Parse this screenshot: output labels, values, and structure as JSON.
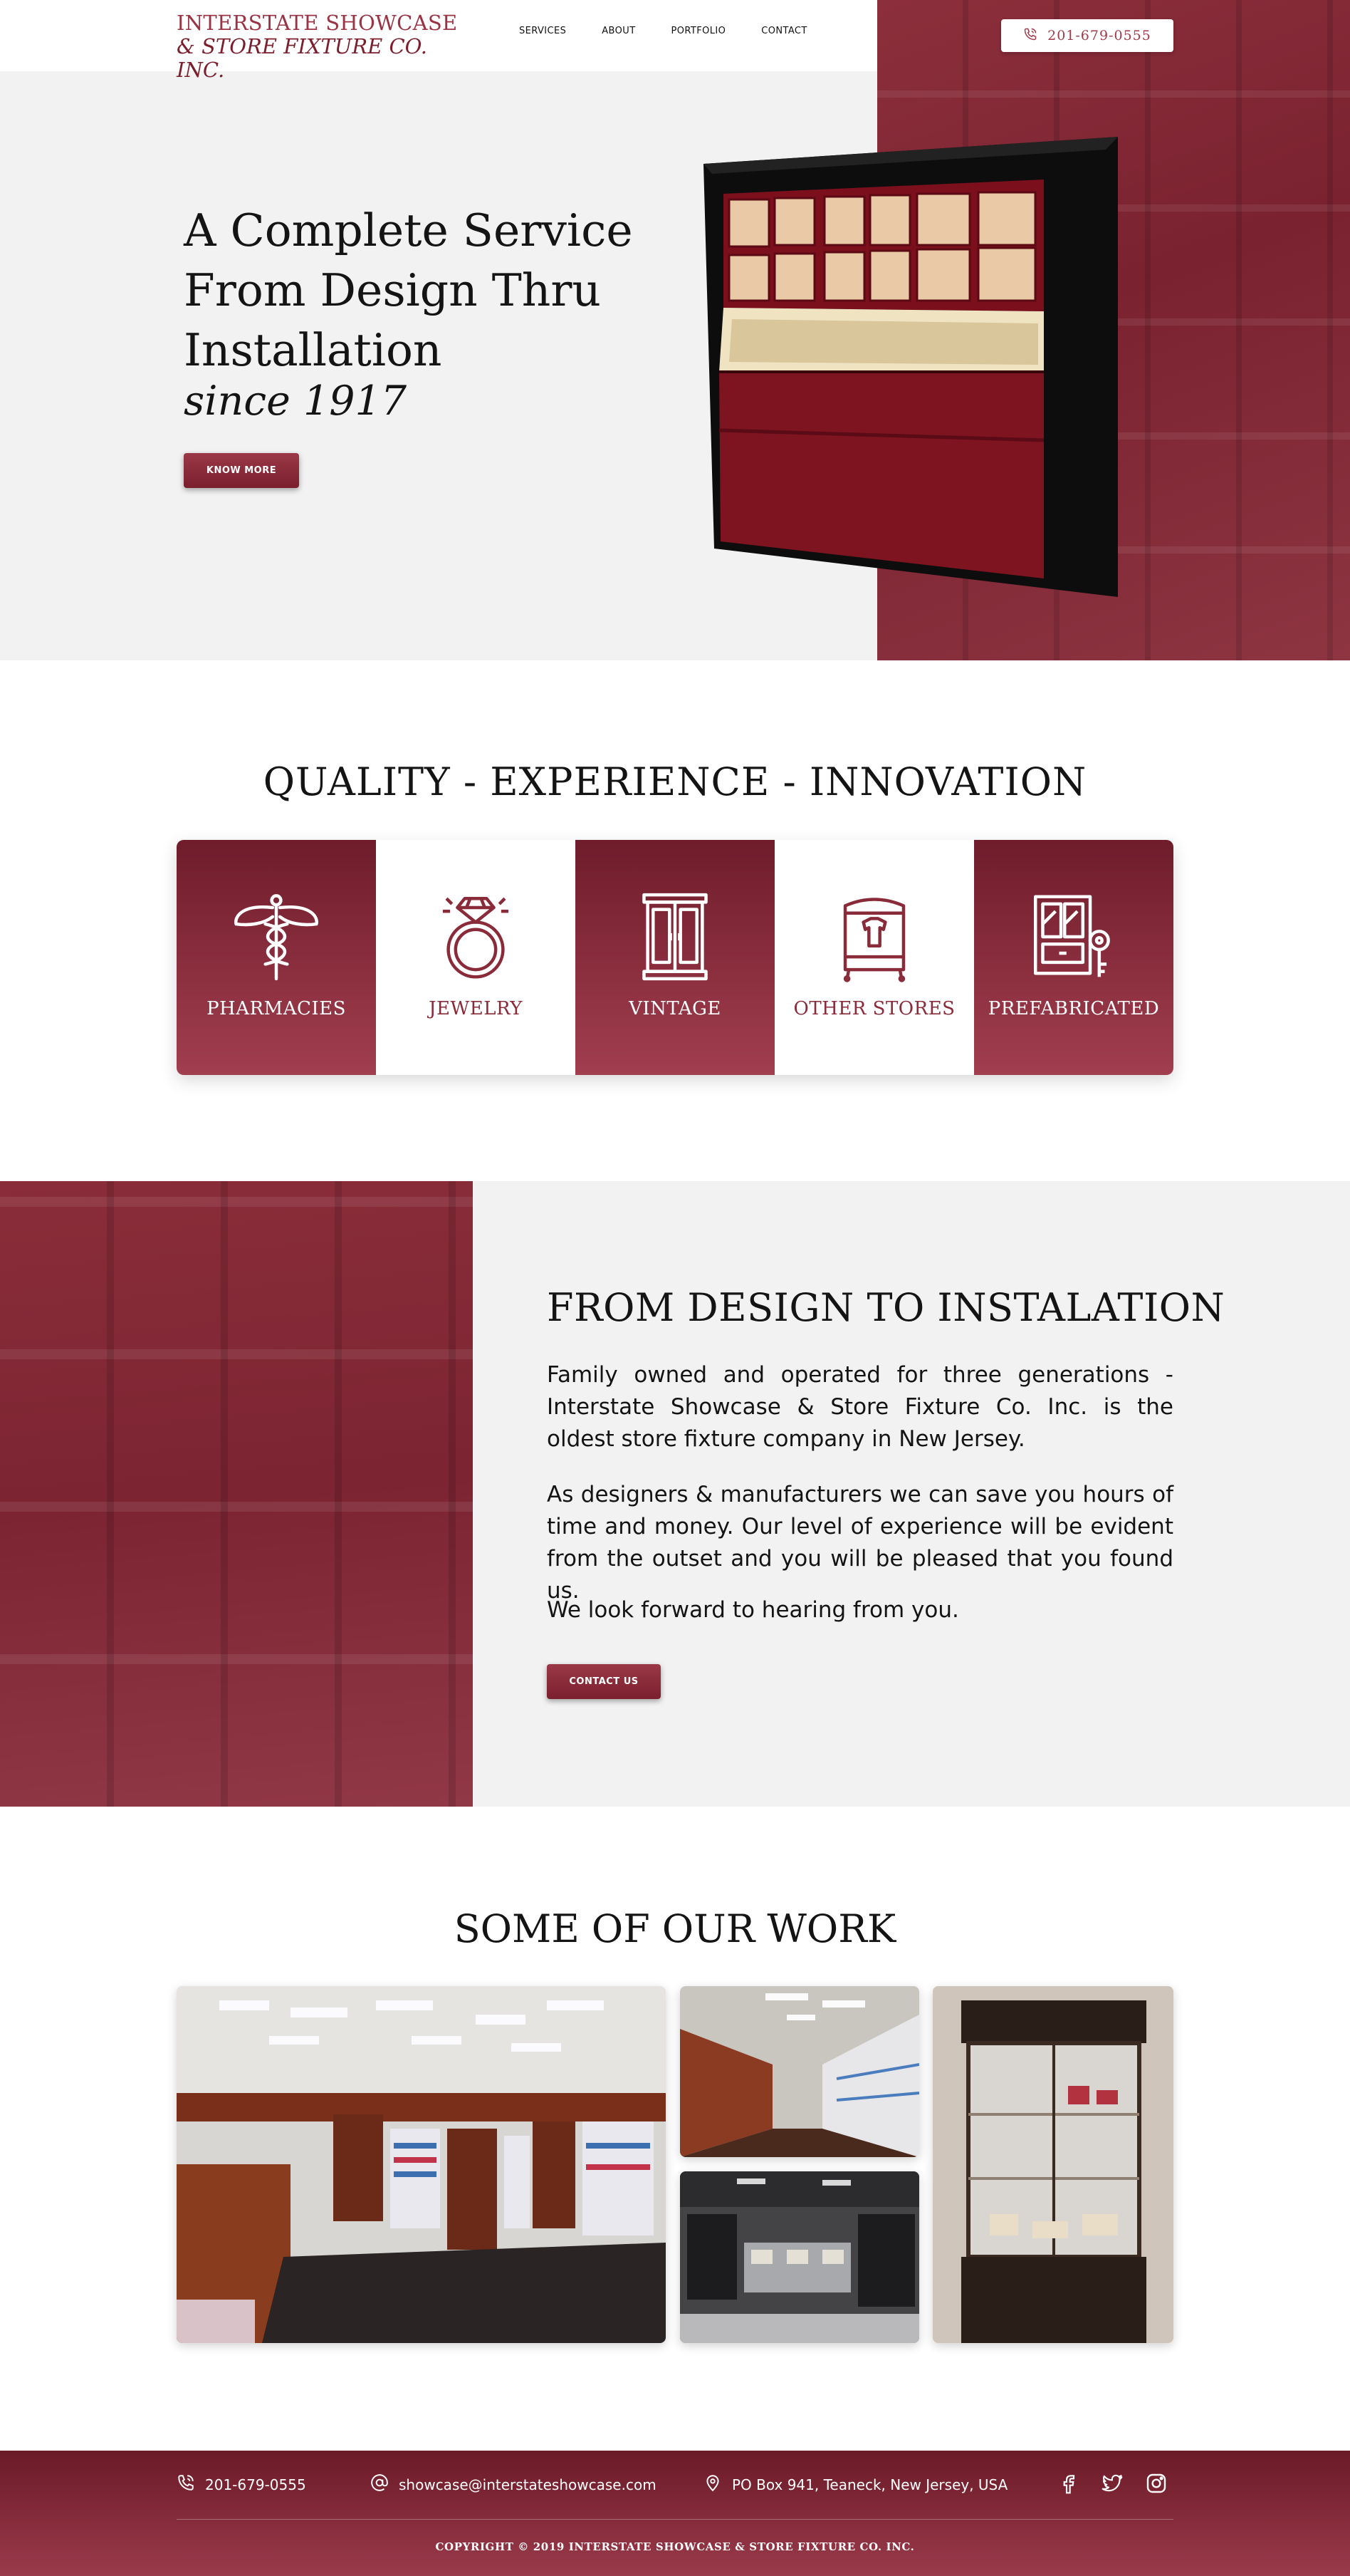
{
  "header": {
    "logo_line1": "INTERSTATE SHOWCASE",
    "logo_line2": "& STORE FIXTURE CO. INC.",
    "nav": [
      "SERVICES",
      "ABOUT",
      "PORTFOLIO",
      "CONTACT"
    ],
    "phone": "201-679-0555",
    "phone_icon": "phone-icon"
  },
  "hero": {
    "title": "A Complete Service From Design Thru Installation",
    "subtitle": "since 1917",
    "button": "KNOW MORE"
  },
  "quality": {
    "title": "QUALITY - EXPERIENCE - INNOVATION",
    "cards": [
      {
        "label": "PHARMACIES",
        "icon": "caduceus-icon",
        "style": "dark"
      },
      {
        "label": "JEWELRY",
        "icon": "ring-icon",
        "style": "light"
      },
      {
        "label": "VINTAGE",
        "icon": "cabinet-icon",
        "style": "dark"
      },
      {
        "label": "OTHER STORES",
        "icon": "wardrobe-icon",
        "style": "light"
      },
      {
        "label": "PREFABRICATED",
        "icon": "key-cabinet-icon",
        "style": "dark"
      }
    ]
  },
  "design": {
    "title": "FROM DESIGN TO INSTALATION",
    "p1": "Family owned and operated for three generations - Interstate Showcase & Store Fixture Co. Inc. is the oldest store fixture company in New Jersey.",
    "p2": "As designers & manufacturers we can save you hours of time and money. Our level of experience will be evident from the outset and you will be pleased that you found us.",
    "p3": "We look forward to hearing from you.",
    "button": "CONTACT US"
  },
  "work": {
    "title": "SOME OF OUR WORK"
  },
  "footer": {
    "phone": "201-679-0555",
    "email": "showcase@interstateshowcase.com",
    "address": "PO Box 941, Teaneck, New Jersey, USA",
    "social": [
      "facebook-icon",
      "twitter-icon",
      "instagram-icon"
    ],
    "copyright": "COPYRIGHT © 2019 INTERSTATE SHOWCASE & STORE FIXTURE CO. INC."
  },
  "colors": {
    "brand": "#8a2b3a",
    "brand_dark": "#6b1a28",
    "hero_bg": "#f3f2f2"
  }
}
